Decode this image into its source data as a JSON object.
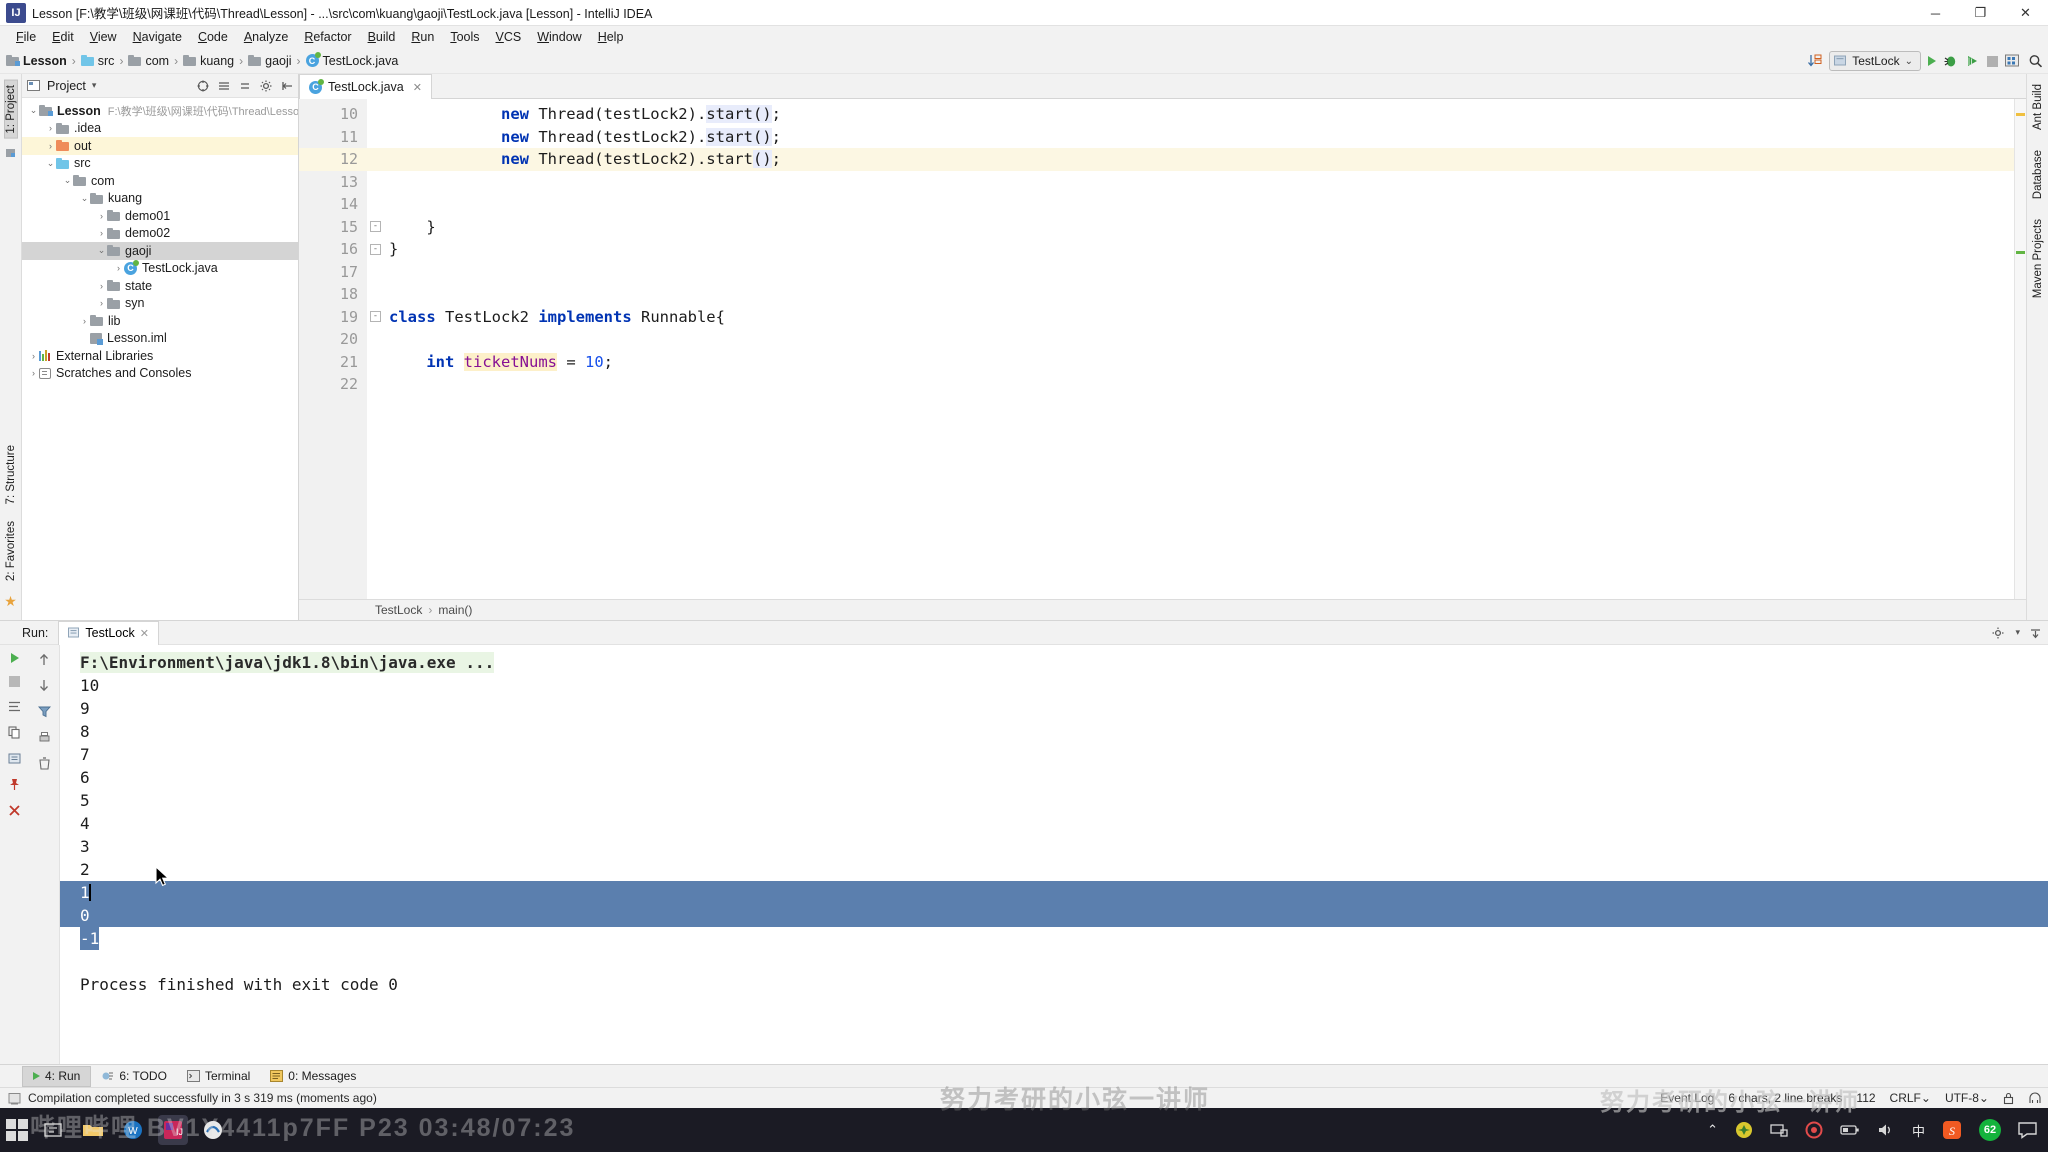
{
  "window": {
    "title": "Lesson [F:\\教学\\班级\\网课班\\代码\\Thread\\Lesson] - ...\\src\\com\\kuang\\gaoji\\TestLock.java [Lesson] - IntelliJ IDEA",
    "app_icon": "IJ",
    "minimize": "─",
    "maximize": "❐",
    "close": "✕"
  },
  "menu": [
    {
      "label": "File"
    },
    {
      "label": "Edit"
    },
    {
      "label": "View"
    },
    {
      "label": "Navigate"
    },
    {
      "label": "Code"
    },
    {
      "label": "Analyze"
    },
    {
      "label": "Refactor"
    },
    {
      "label": "Build"
    },
    {
      "label": "Run"
    },
    {
      "label": "Tools"
    },
    {
      "label": "VCS"
    },
    {
      "label": "Window"
    },
    {
      "label": "Help"
    }
  ],
  "breadcrumb": [
    {
      "label": "Lesson",
      "icon": "folder-module-icon"
    },
    {
      "label": "src",
      "icon": "folder-source-icon"
    },
    {
      "label": "com",
      "icon": "folder-icon"
    },
    {
      "label": "kuang",
      "icon": "folder-icon"
    },
    {
      "label": "gaoji",
      "icon": "folder-icon"
    },
    {
      "label": "TestLock.java",
      "icon": "java-class-icon"
    }
  ],
  "toolbar_right": {
    "sort_icon": "sort-numeric-icon",
    "run_config": "TestLock",
    "chevron": "⌄",
    "run_icon": "run-icon",
    "debug_icon": "debug-icon",
    "coverage_icon": "run-with-coverage-icon",
    "stop_icon": "stop-icon",
    "layout_icon": "restore-layout-icon",
    "search_icon": "search-everywhere-icon"
  },
  "left_strip": {
    "project_label": "1: Project",
    "structure_label": "7: Structure",
    "favorites_label": "2: Favorites",
    "star_icon": "star-icon"
  },
  "right_strip": {
    "items": [
      "Ant Build",
      "Database",
      "Maven Projects"
    ]
  },
  "project_pane": {
    "title": "Project",
    "chevron": "▾",
    "settings_icon": "gear-icon",
    "collapse_icon": "collapse-all-icon",
    "hide_icon": "hide-icon",
    "target_icon": "scroll-from-source-icon",
    "tree": [
      {
        "label": "Lesson",
        "hint": "F:\\教学\\班级\\网课班\\代码\\Thread\\Lesson",
        "depth": 0,
        "arrow": "⌄",
        "icon": "folder-module-icon",
        "bold": true,
        "state": "normal"
      },
      {
        "label": ".idea",
        "hint": "",
        "depth": 1,
        "arrow": "›",
        "icon": "folder-icon",
        "bold": false,
        "state": "normal"
      },
      {
        "label": "out",
        "hint": "",
        "depth": 1,
        "arrow": "›",
        "icon": "folder-orange-icon",
        "bold": false,
        "state": "highlight"
      },
      {
        "label": "src",
        "hint": "",
        "depth": 1,
        "arrow": "⌄",
        "icon": "folder-source-icon",
        "bold": false,
        "state": "normal"
      },
      {
        "label": "com",
        "hint": "",
        "depth": 2,
        "arrow": "⌄",
        "icon": "folder-icon",
        "bold": false,
        "state": "normal"
      },
      {
        "label": "kuang",
        "hint": "",
        "depth": 3,
        "arrow": "⌄",
        "icon": "folder-icon",
        "bold": false,
        "state": "normal"
      },
      {
        "label": "demo01",
        "hint": "",
        "depth": 4,
        "arrow": "›",
        "icon": "folder-icon",
        "bold": false,
        "state": "normal"
      },
      {
        "label": "demo02",
        "hint": "",
        "depth": 4,
        "arrow": "›",
        "icon": "folder-icon",
        "bold": false,
        "state": "normal"
      },
      {
        "label": "gaoji",
        "hint": "",
        "depth": 4,
        "arrow": "⌄",
        "icon": "folder-icon",
        "bold": false,
        "state": "selected"
      },
      {
        "label": "TestLock.java",
        "hint": "",
        "depth": 5,
        "arrow": "›",
        "icon": "java-class-icon",
        "bold": false,
        "state": "normal"
      },
      {
        "label": "state",
        "hint": "",
        "depth": 4,
        "arrow": "›",
        "icon": "folder-icon",
        "bold": false,
        "state": "normal"
      },
      {
        "label": "syn",
        "hint": "",
        "depth": 4,
        "arrow": "›",
        "icon": "folder-icon",
        "bold": false,
        "state": "normal"
      },
      {
        "label": "lib",
        "hint": "",
        "depth": 3,
        "arrow": "›",
        "icon": "folder-icon",
        "bold": false,
        "state": "normal"
      },
      {
        "label": "Lesson.iml",
        "hint": "",
        "depth": 3,
        "arrow": "",
        "icon": "iml-file-icon",
        "bold": false,
        "state": "normal"
      },
      {
        "label": "External Libraries",
        "hint": "",
        "depth": 0,
        "arrow": "›",
        "icon": "libraries-icon",
        "bold": false,
        "state": "normal"
      },
      {
        "label": "Scratches and Consoles",
        "hint": "",
        "depth": 0,
        "arrow": "›",
        "icon": "scratches-icon",
        "bold": false,
        "state": "normal"
      }
    ]
  },
  "editor": {
    "tab": {
      "label": "TestLock.java",
      "icon": "java-class-icon",
      "close": "✕"
    },
    "lines": [
      {
        "no": "10",
        "fold": "",
        "current": false,
        "tokens": [
          {
            "t": "            ",
            "c": ""
          },
          {
            "t": "new",
            "c": "kw"
          },
          {
            "t": " Thread(testLock2).",
            "c": ""
          },
          {
            "t": "start()",
            "c": "mcall"
          },
          {
            "t": ";",
            "c": ""
          }
        ]
      },
      {
        "no": "11",
        "fold": "",
        "current": false,
        "tokens": [
          {
            "t": "            ",
            "c": ""
          },
          {
            "t": "new",
            "c": "kw"
          },
          {
            "t": " Thread(testLock2).",
            "c": ""
          },
          {
            "t": "start()",
            "c": "mcall"
          },
          {
            "t": ";",
            "c": ""
          }
        ]
      },
      {
        "no": "12",
        "fold": "",
        "current": true,
        "tokens": [
          {
            "t": "            ",
            "c": ""
          },
          {
            "t": "new",
            "c": "kw"
          },
          {
            "t": " Thread(testLock2).",
            "c": ""
          },
          {
            "t": "start",
            "c": ""
          },
          {
            "t": "()",
            "c": "mcall"
          },
          {
            "t": ";",
            "c": ""
          }
        ]
      },
      {
        "no": "13",
        "fold": "",
        "current": false,
        "tokens": []
      },
      {
        "no": "14",
        "fold": "",
        "current": false,
        "tokens": []
      },
      {
        "no": "15",
        "fold": "-",
        "current": false,
        "tokens": [
          {
            "t": "    }",
            "c": ""
          }
        ]
      },
      {
        "no": "16",
        "fold": "-",
        "current": false,
        "tokens": [
          {
            "t": "}",
            "c": ""
          }
        ]
      },
      {
        "no": "17",
        "fold": "",
        "current": false,
        "tokens": []
      },
      {
        "no": "18",
        "fold": "",
        "current": false,
        "tokens": []
      },
      {
        "no": "19",
        "fold": "-",
        "current": false,
        "tokens": [
          {
            "t": "class",
            "c": "kw"
          },
          {
            "t": " TestLock2 ",
            "c": ""
          },
          {
            "t": "implements",
            "c": "kw"
          },
          {
            "t": " Runnable{",
            "c": ""
          }
        ]
      },
      {
        "no": "20",
        "fold": "",
        "current": false,
        "tokens": []
      },
      {
        "no": "21",
        "fold": "",
        "current": false,
        "tokens": [
          {
            "t": "    ",
            "c": ""
          },
          {
            "t": "int",
            "c": "kw"
          },
          {
            "t": " ",
            "c": ""
          },
          {
            "t": "ticketNums",
            "c": "fld hlb"
          },
          {
            "t": " = ",
            "c": ""
          },
          {
            "t": "10",
            "c": "num"
          },
          {
            "t": ";",
            "c": ""
          }
        ]
      },
      {
        "no": "22",
        "fold": "",
        "current": false,
        "tokens": []
      }
    ],
    "status_path": [
      "TestLock",
      "main()"
    ],
    "status_sep": "›"
  },
  "run_window": {
    "label": "Run:",
    "tab": {
      "label": "TestLock",
      "icon": "run-config-icon",
      "close": "✕"
    },
    "head_right": {
      "settings_icon": "gear-icon",
      "hide_icon": "hide-icon"
    },
    "side_buttons": [
      "rerun-icon",
      "scroll-up-icon",
      "stop-icon",
      "scroll-down-icon",
      "soft-wrap-icon",
      "filter-icon",
      "copy-icon",
      "print-icon",
      "export-icon",
      "clear-all-icon",
      "pin-icon",
      "close-icon"
    ],
    "console": {
      "command": "F:\\Environment\\java\\jdk1.8\\bin\\java.exe ...",
      "output": [
        "10",
        "9",
        "8",
        "7",
        "6",
        "5",
        "4",
        "3",
        "2",
        "1",
        "0",
        "-1"
      ],
      "selection_start_index": 9,
      "selection_end_index": 11,
      "blank_line": "",
      "exit_message": "Process finished with exit code 0"
    }
  },
  "bottom_bar": [
    {
      "label": "4: Run",
      "icon": "run-icon",
      "selected": true
    },
    {
      "label": "6: TODO",
      "icon": "todo-icon",
      "selected": false
    },
    {
      "label": "Terminal",
      "icon": "terminal-icon",
      "selected": false
    },
    {
      "label": "0: Messages",
      "icon": "messages-icon",
      "selected": false
    }
  ],
  "status_bar": {
    "icon": "build-icon",
    "message": "Compilation completed successfully in 3 s 319 ms (moments ago)",
    "chars": "6 chars, 2 line breaks",
    "position": "112",
    "line_separator": "CRLF⌄",
    "encoding": "UTF-8⌄",
    "lock_icon": "lock-icon",
    "hector_icon": "hector-icon",
    "event_log": "Event Log"
  },
  "taskbar": {
    "start_icon": "windows-start-icon",
    "items": [
      "task-manager-icon",
      "file-explorer-icon",
      "wps-icon",
      "idea-icon",
      "browser-icon"
    ],
    "tray": {
      "chevron": "⌃",
      "icons": [
        "shield-icon",
        "network-icon",
        "record-icon",
        "battery-icon",
        "volume-icon"
      ],
      "ime": "中",
      "sogou": "S",
      "badge": "62",
      "notification_icon": "notification-icon"
    }
  },
  "watermarks": {
    "main": "努力考研的小弦一讲师",
    "overlay": "努力考研的小弦一讲师",
    "bili": "哔哩哔哩 BV1Y4411p7FF P23  03:48/07:23"
  }
}
